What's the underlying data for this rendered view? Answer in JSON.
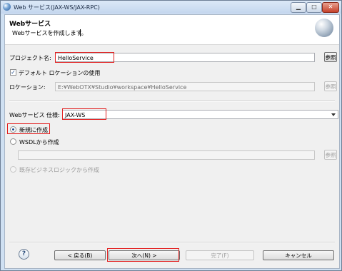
{
  "window": {
    "title": "Web サービス(JAX-WS/JAX-RPC)",
    "controls": {
      "minimize": "▁",
      "maximize": "□",
      "close": "✕"
    }
  },
  "header": {
    "title": "Webサービス",
    "description": "Webサービスを作成します。",
    "icon": "web-service-globe-icon"
  },
  "project": {
    "label": "プロジェクト名:",
    "value": "HelloService",
    "browse": "参照"
  },
  "default_location": {
    "label": "デフォルト ロケーションの使用",
    "checked": true
  },
  "location": {
    "label": "ロケーション:",
    "value": "E:¥WebOTX¥Studio¥workspace¥HelloService",
    "browse": "参照"
  },
  "spec": {
    "label": "Webサービス 仕様:",
    "value": "JAX-WS"
  },
  "creation": {
    "new": {
      "label": "新規に作成",
      "selected": true
    },
    "wsdl": {
      "label": "WSDLから作成",
      "selected": false,
      "browse": "参照"
    },
    "existing": {
      "label": "既存ビジネスロジックから作成",
      "selected": false
    }
  },
  "footer": {
    "help": "?",
    "back": "< 戻る(B)",
    "next": "次へ(N) >",
    "finish": "完了(F)",
    "cancel": "キャンセル"
  },
  "colors": {
    "highlight": "#e21f1f",
    "accent": "#1c4a8c"
  }
}
